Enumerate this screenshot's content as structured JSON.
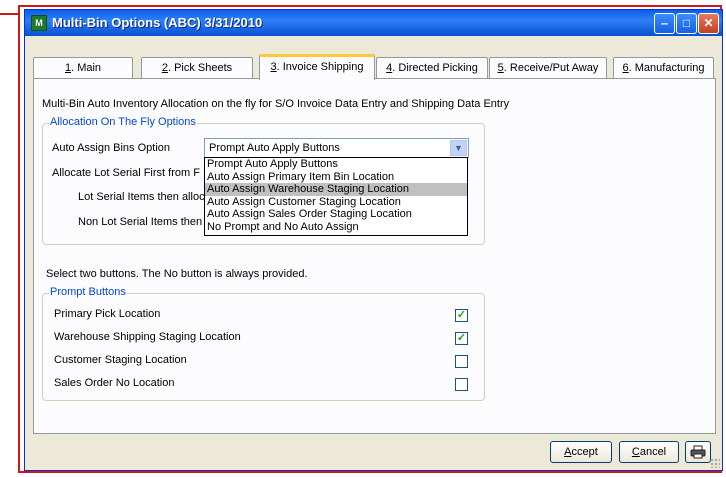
{
  "window": {
    "title": "Multi-Bin Options (ABC) 3/31/2010",
    "app_icon": "M",
    "controls": {
      "minimize": "‒",
      "maximize": "□",
      "close": "✕"
    }
  },
  "tabs": [
    {
      "key": "1",
      "rest": ". Main"
    },
    {
      "key": "2",
      "rest": ". Pick Sheets"
    },
    {
      "key": "3",
      "rest": ". Invoice Shipping"
    },
    {
      "key": "4",
      "rest": ". Directed Picking"
    },
    {
      "key": "5",
      "rest": ". Receive/Put Away"
    },
    {
      "key": "6",
      "rest": ". Manufacturing"
    }
  ],
  "active_tab": 2,
  "description": "Multi-Bin Auto Inventory Allocation on the fly for S/O Invoice Data Entry and Shipping Data Entry",
  "allocation": {
    "group_title": "Allocation On The Fly Options",
    "auto_assign_label": "Auto Assign Bins Option",
    "auto_assign_value": "Prompt Auto Apply Buttons",
    "allocate_lot_label": "Allocate Lot Serial First from F",
    "lot_items_label": "Lot Serial Items then alloc",
    "non_lot_items_label": "Non Lot Serial Items then",
    "options": [
      "Prompt Auto Apply Buttons",
      "Auto Assign Primary Item Bin Location",
      "Auto Assign Warehouse Staging Location",
      "Auto Assign Customer Staging Location",
      "Auto Assign Sales Order Staging Location",
      "No Prompt and No Auto Assign"
    ],
    "highlighted_option": 2
  },
  "select_note": "Select two buttons.  The No button is always provided.",
  "prompt_buttons": {
    "group_title": "Prompt Buttons",
    "items": [
      {
        "label": "Primary Pick Location",
        "checked": true
      },
      {
        "label": "Warehouse Shipping Staging Location",
        "checked": true
      },
      {
        "label": "Customer Staging Location",
        "checked": false
      },
      {
        "label": "Sales Order No Location",
        "checked": false
      }
    ]
  },
  "footer": {
    "accept_key": "A",
    "accept_rest": "ccept",
    "cancel_key": "C",
    "cancel_rest": "ancel",
    "print_icon": "printer-icon"
  },
  "colors": {
    "title_bar": "#0a5fe8",
    "group_title": "#0046d5",
    "callout": "#d01818",
    "check": "#21a121"
  }
}
